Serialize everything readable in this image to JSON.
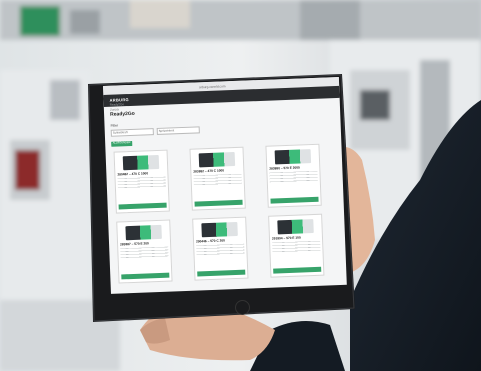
{
  "screen": {
    "url": "arburg-xworld.com",
    "logo": "ARBURG",
    "menu_label": "Ready2Go",
    "back_label": "Zurück",
    "page_title": "Ready2Go",
    "filter_label": "Filter",
    "select_1": "Schließkraft",
    "select_2": "Spritzeinheit",
    "chip_label": "ALLROUNDER",
    "cards": [
      {
        "title": "280482 – 470 C 1000"
      },
      {
        "title": "283882 – 470 C 1000"
      },
      {
        "title": "283880 – 570 E 2000"
      },
      {
        "title": "283887 – 570 E 200"
      },
      {
        "title": "290446 – 570 C 200"
      },
      {
        "title": "291894 – 570 E 100"
      }
    ]
  },
  "colors": {
    "accent_green": "#37a36a",
    "app_bar": "#2b2d30",
    "tablet_bezel": "#1a1b1d"
  }
}
